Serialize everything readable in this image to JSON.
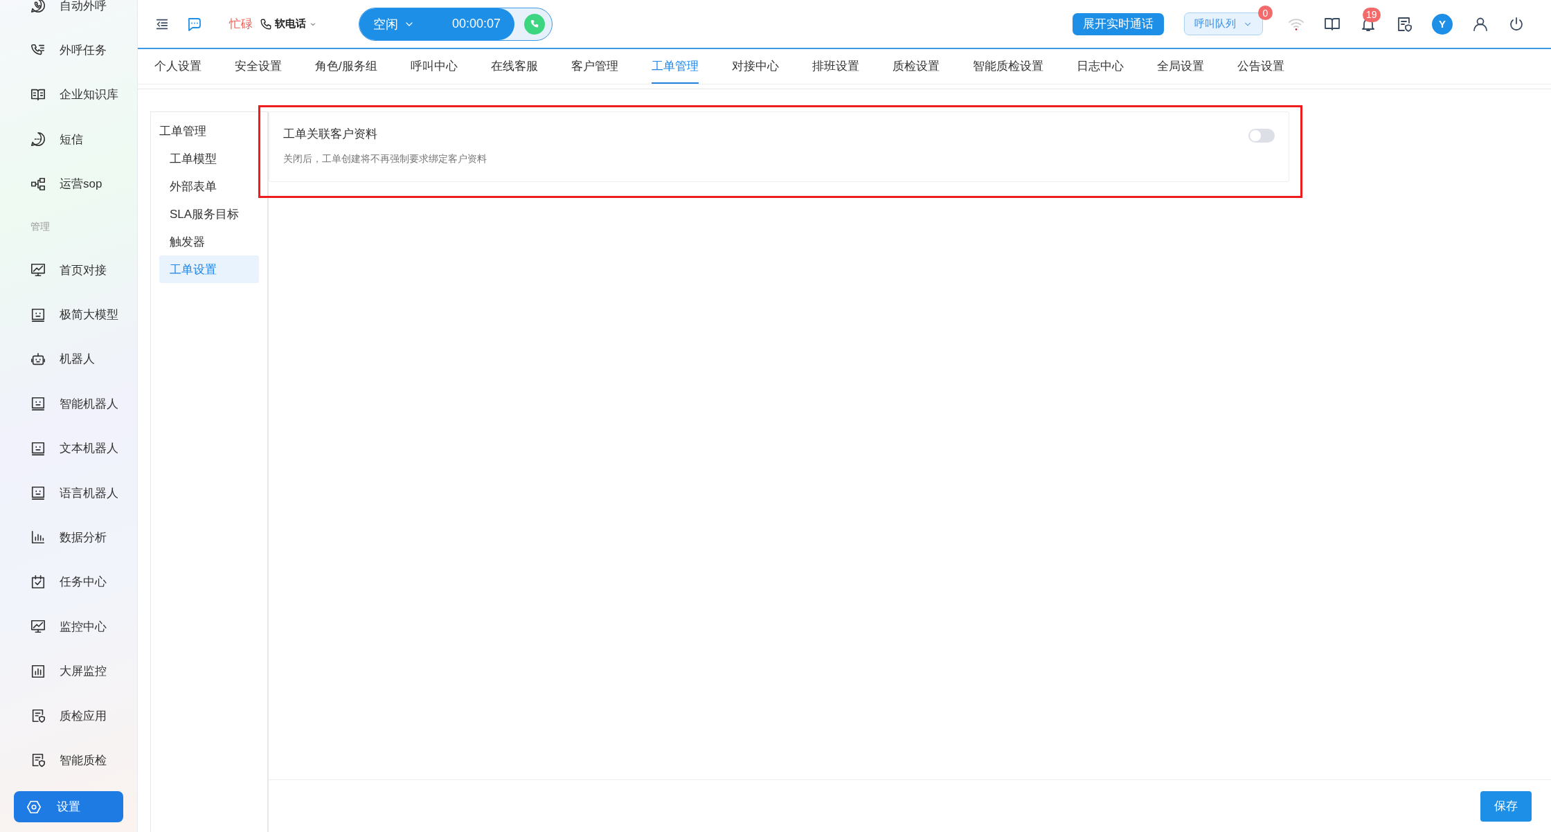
{
  "sidebar": {
    "groups": [
      {
        "items": [
          {
            "label": "自动外呼",
            "selected": false
          },
          {
            "label": "外呼任务",
            "selected": false
          },
          {
            "label": "企业知识库",
            "selected": false
          },
          {
            "label": "短信",
            "selected": false
          },
          {
            "label": "运营sop",
            "selected": false
          }
        ]
      },
      {
        "title": "管理",
        "items": [
          {
            "label": "首页对接",
            "selected": false
          },
          {
            "label": "极简大模型",
            "selected": false
          },
          {
            "label": "机器人",
            "selected": false
          },
          {
            "label": "智能机器人",
            "selected": false
          },
          {
            "label": "文本机器人",
            "selected": false
          },
          {
            "label": "语言机器人",
            "selected": false
          },
          {
            "label": "数据分析",
            "selected": false
          },
          {
            "label": "任务中心",
            "selected": false
          },
          {
            "label": "监控中心",
            "selected": false
          },
          {
            "label": "大屏监控",
            "selected": false
          },
          {
            "label": "质检应用",
            "selected": false
          },
          {
            "label": "智能质检",
            "selected": false
          }
        ]
      }
    ],
    "settings_button": {
      "label": "设置",
      "selected": true
    }
  },
  "topbar": {
    "busy_label": "忙碌",
    "phone_mode": "软电话",
    "status": {
      "label": "空闲",
      "timer": "00:00:07"
    },
    "expand_button": "展开实时通话",
    "queue": {
      "label": "呼叫队列",
      "badge": "0"
    },
    "notifications_badge": "19",
    "avatar": "Y"
  },
  "tabs": [
    {
      "label": "个人设置",
      "selected": false
    },
    {
      "label": "安全设置",
      "selected": false
    },
    {
      "label": "角色/服务组",
      "selected": false
    },
    {
      "label": "呼叫中心",
      "selected": false
    },
    {
      "label": "在线客服",
      "selected": false
    },
    {
      "label": "客户管理",
      "selected": false
    },
    {
      "label": "工单管理",
      "selected": true
    },
    {
      "label": "对接中心",
      "selected": false
    },
    {
      "label": "排班设置",
      "selected": false
    },
    {
      "label": "质检设置",
      "selected": false
    },
    {
      "label": "智能质检设置",
      "selected": false
    },
    {
      "label": "日志中心",
      "selected": false
    },
    {
      "label": "全局设置",
      "selected": false
    },
    {
      "label": "公告设置",
      "selected": false
    }
  ],
  "subnav": {
    "title": "工单管理",
    "items": [
      {
        "label": "工单模型",
        "selected": false
      },
      {
        "label": "外部表单",
        "selected": false
      },
      {
        "label": "SLA服务目标",
        "selected": false
      },
      {
        "label": "触发器",
        "selected": false
      },
      {
        "label": "工单设置",
        "selected": true
      }
    ]
  },
  "setting": {
    "title": "工单关联客户资料",
    "description": "关闭后，工单创建将不再强制要求绑定客户资料",
    "on": false
  },
  "save_button": "保存"
}
